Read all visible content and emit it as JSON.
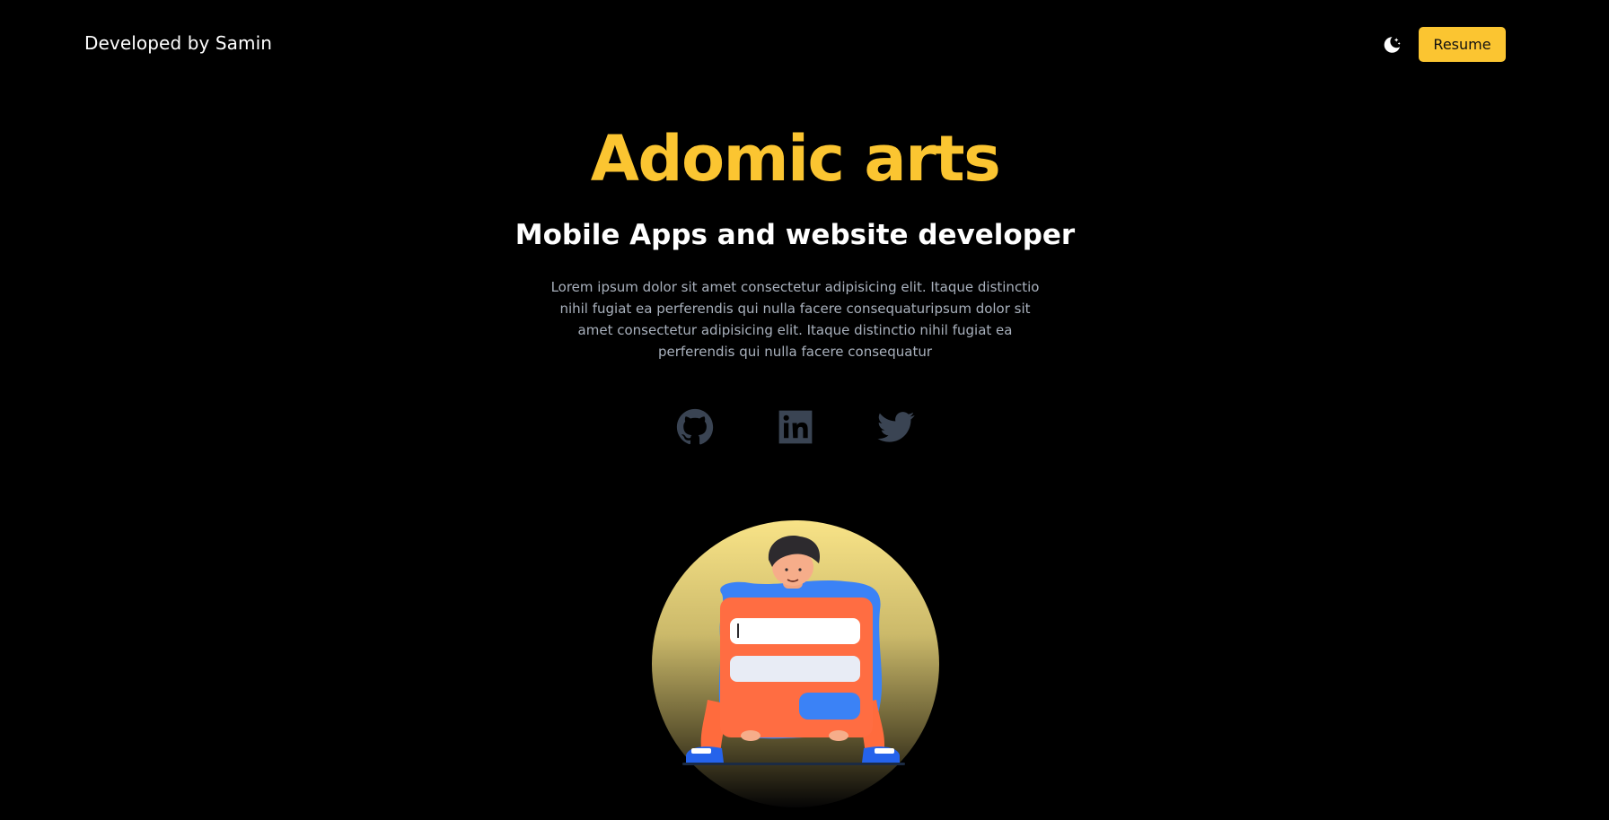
{
  "header": {
    "brand": "Developed by Samin",
    "theme_toggle_icon": "moon-stars-icon",
    "resume_label": "Resume"
  },
  "hero": {
    "title": "Adomic arts",
    "subtitle": "Mobile Apps and website developer",
    "description": "Lorem ipsum dolor sit amet consectetur adipisicing elit. Itaque distinctio nihil fugiat ea perferendis qui nulla facere consequaturipsum dolor sit amet consectetur adipisicing elit. Itaque distinctio nihil fugiat ea perferendis qui nulla facere consequatur"
  },
  "socials": [
    {
      "icon": "github-icon"
    },
    {
      "icon": "linkedin-icon"
    },
    {
      "icon": "twitter-icon"
    }
  ],
  "colors": {
    "background": "#000000",
    "accent": "#FBC531",
    "social_icon": "#3a4453",
    "description_text": "#a9b1bd"
  }
}
